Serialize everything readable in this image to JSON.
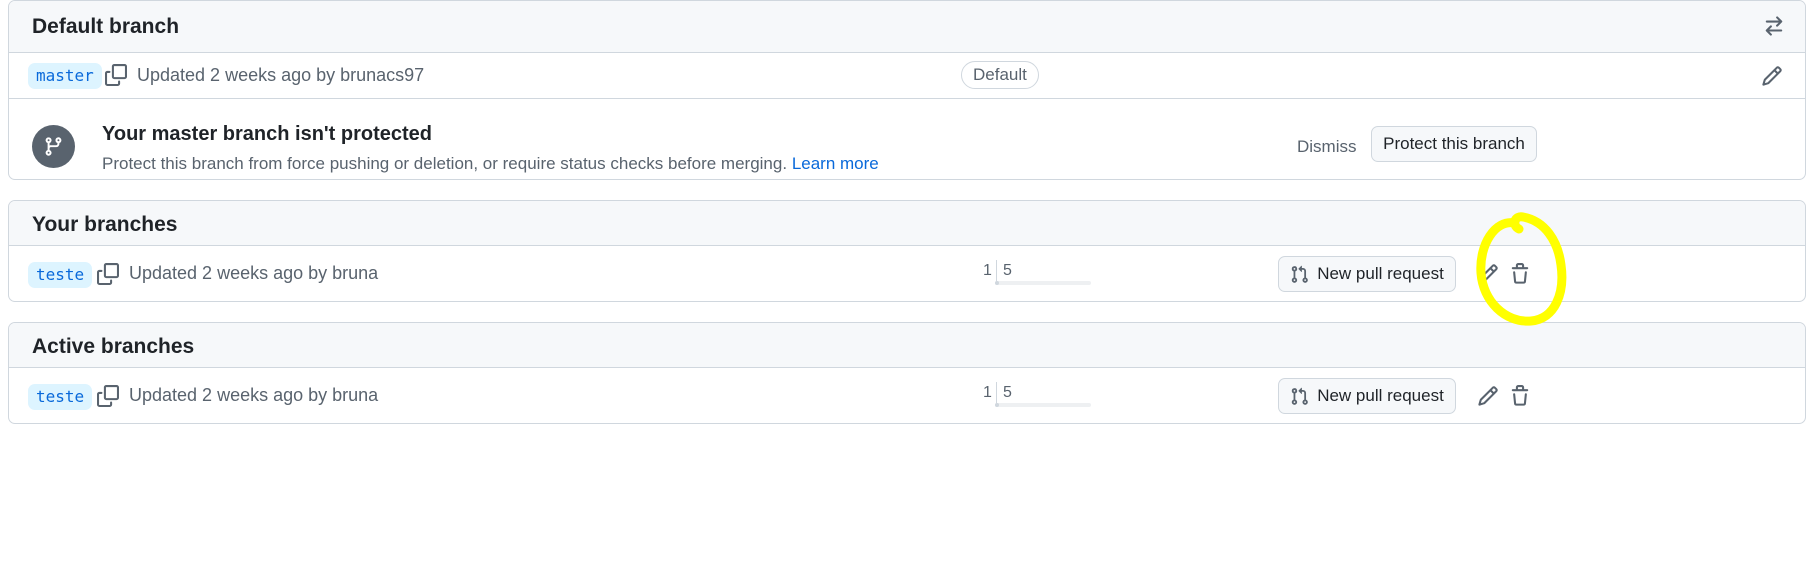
{
  "default_section": {
    "title": "Default branch",
    "branch": {
      "name": "master",
      "meta": "Updated 2 weeks ago by brunacs97",
      "badge": "Default"
    },
    "protect_notice": {
      "title": "Your master branch isn't protected",
      "description": "Protect this branch from force pushing or deletion, or require status checks before merging.",
      "link": "Learn more",
      "dismiss": "Dismiss",
      "protect_button": "Protect this branch"
    }
  },
  "your_section": {
    "title": "Your branches",
    "branches": [
      {
        "name": "teste",
        "meta": "Updated 2 weeks ago by bruna",
        "behind": "1",
        "ahead": "5",
        "pr_button": "New pull request"
      }
    ]
  },
  "active_section": {
    "title": "Active branches",
    "branches": [
      {
        "name": "teste",
        "meta": "Updated 2 weeks ago by bruna",
        "behind": "1",
        "ahead": "5",
        "pr_button": "New pull request"
      }
    ]
  },
  "colors": {
    "accent": "#0969da",
    "annotation": "#ffff00"
  },
  "icons": [
    "switch-arrows-icon",
    "copy-icon",
    "pencil-icon",
    "branch-icon",
    "pull-request-icon",
    "trash-icon"
  ]
}
